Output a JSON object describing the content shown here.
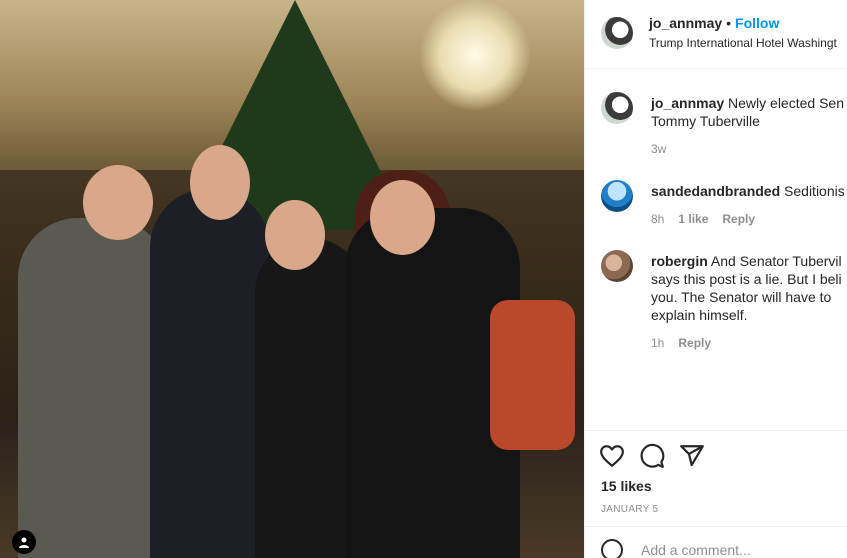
{
  "post": {
    "username": "jo_annmay",
    "follow_label": "Follow",
    "location": "Trump International Hotel Washingt"
  },
  "comments": [
    {
      "username": "jo_annmay",
      "text": "Newly elected Sen\nTommy Tuberville",
      "time": "3w"
    },
    {
      "username": "sandedandbranded",
      "text": "Seditionis",
      "time": "8h",
      "likes": "1 like",
      "reply": "Reply"
    },
    {
      "username": "robergin",
      "text": "And Senator Tubervil\nsays this post is a lie. But I beli\nyou. The Senator will have to\nexplain himself.",
      "time": "1h",
      "reply": "Reply"
    }
  ],
  "actions": {
    "likes": "15 likes",
    "date": "JANUARY 5",
    "comment_placeholder": "Add a comment..."
  },
  "icons": [
    "heart-icon",
    "comment-icon",
    "share-icon",
    "emoji-icon",
    "user-tag-icon"
  ]
}
